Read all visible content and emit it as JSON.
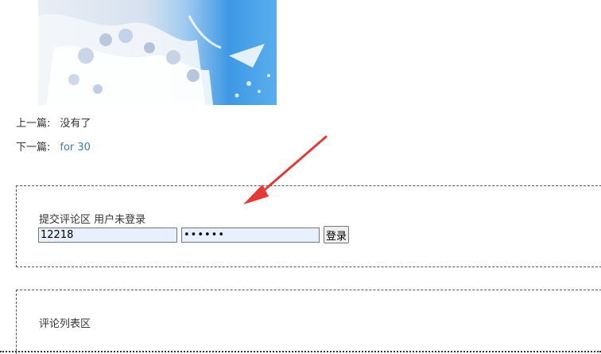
{
  "article": {
    "image_alt": "illustration"
  },
  "navigation": {
    "prev_label": "上一篇:",
    "prev_value": "没有了",
    "next_label": "下一篇:",
    "next_value": "for 30"
  },
  "comment_form": {
    "title": "提交评论区 用户未登录",
    "username_value": "12218",
    "password_value": "123456",
    "login_label": "登录"
  },
  "comment_list": {
    "title": "评论列表区"
  },
  "colors": {
    "link": "#3d7ab8",
    "arrow": "#e53935",
    "input_autofill_bg": "#e8f0fe"
  }
}
